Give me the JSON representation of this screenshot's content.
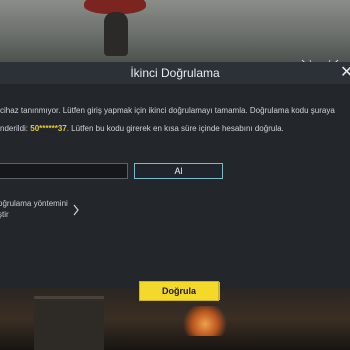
{
  "dialog": {
    "title": "İkinci Doğrulama",
    "close_glyph": "✕",
    "message_line1": "cihaz tanınmıyor. Lütfen giriş yapmak için ikinci doğrulamayı tamamla. Doğrulama kodu şuraya",
    "message_line2_prefix": "nderildi: ",
    "masked_phone": "50******37",
    "message_line2_suffix": ". Lütfen bu kodu girerek en kısa süre içinde hesabını doğrula.",
    "code_input": {
      "value": "",
      "placeholder": ""
    },
    "get_code_label": "Al",
    "change_method_label": "oğrulama yöntemini\nştir",
    "verify_label": "Doğrula",
    "accent_yellow": "#f4d82a",
    "accent_cyan": "#7fb9c8"
  },
  "icons": {
    "close": "close-icon",
    "chevron": "chevron-right-icon"
  }
}
